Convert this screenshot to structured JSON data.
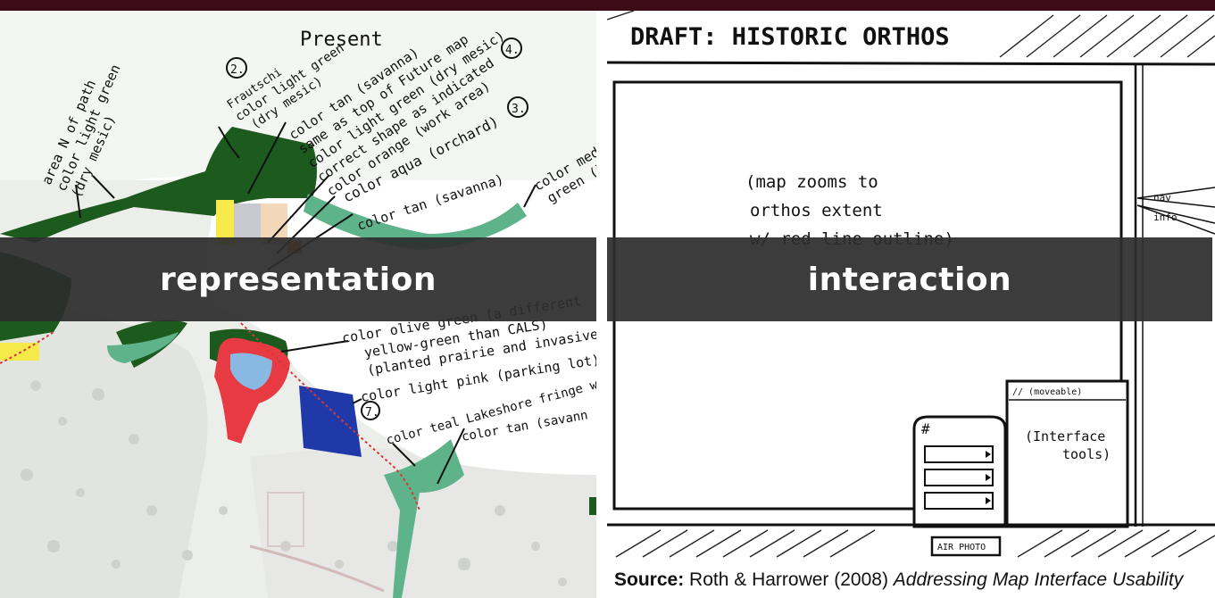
{
  "slide": {
    "left_label": "representation",
    "right_label": "interaction",
    "source": {
      "label": "Source:",
      "citation": "Roth & Harrower (2008)",
      "title": "Addressing Map Interface Usability"
    }
  },
  "left_panel": {
    "annotations": {
      "present": "Present",
      "n2": "2.",
      "n3": "3.",
      "n4": "4.",
      "n7": "7.",
      "path_1": "area N of path",
      "path_2": "color light green",
      "path_3": "(dry mesic)",
      "fraut_1": "Frautschi",
      "fraut_2": "color light green",
      "fraut_3": "(dry mesic)",
      "tan_1": "color tan (savanna)",
      "tan_2": "same as top of Future map",
      "tan_3": "color light green (dry mesic)",
      "tan_4": "correct shape as indicated",
      "tan_5": "color orange (work area)",
      "aqua": "color aqua (orchard)",
      "tan_savanna": "color tan (savanna)",
      "med_1": "color med",
      "med_2": "green (l",
      "olive_1": "color olive green (a different",
      "olive_2": "yellow-green than CALS)",
      "olive_3": "(planted prairie and invasives",
      "pink": "color light pink (parking lot)",
      "teal": "color teal Lakeshore fringe wo",
      "tan_savan": "color tan (savann"
    }
  },
  "right_panel": {
    "header": "DRAFT: HISTORIC ORTHOS",
    "map_note_1": "(map zooms to",
    "map_note_2": "orthos extent",
    "map_note_3": "w/ red line outline)",
    "side_tab_1": "nav",
    "side_tab_2": "info",
    "panel_header": "// (moveable)",
    "panel_text_1": "(Interface",
    "panel_text_2": "tools)",
    "list_header": "#",
    "air_photo": "AIR PHOTO"
  },
  "colors": {
    "top_bar": "#3e0a17",
    "overlay": "#2d2d2d",
    "dark_green": "#1c5a1e",
    "teal": "#5fb38b",
    "red": "#e83a43",
    "blue": "#89b8e3",
    "yellow": "#f6e94a",
    "orange": "#f07a22",
    "tan": "#f2d7b8",
    "navy": "#1f3aa8"
  }
}
